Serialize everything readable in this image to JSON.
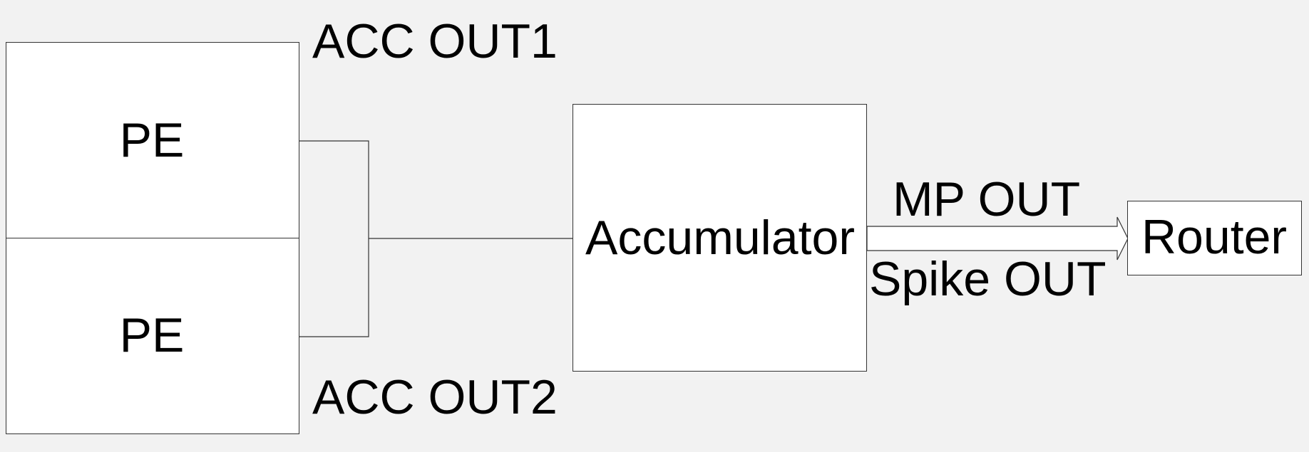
{
  "blocks": {
    "pe_top": "PE",
    "pe_bottom": "PE",
    "accumulator": "Accumulator",
    "router": "Router"
  },
  "labels": {
    "acc_out1": "ACC OUT1",
    "acc_out2": "ACC OUT2",
    "mp_out": "MP OUT",
    "spike_out": "Spike OUT"
  },
  "colors": {
    "background": "#f2f2f2",
    "block_fill": "#ffffff",
    "stroke": "#333333",
    "text": "#000000"
  }
}
